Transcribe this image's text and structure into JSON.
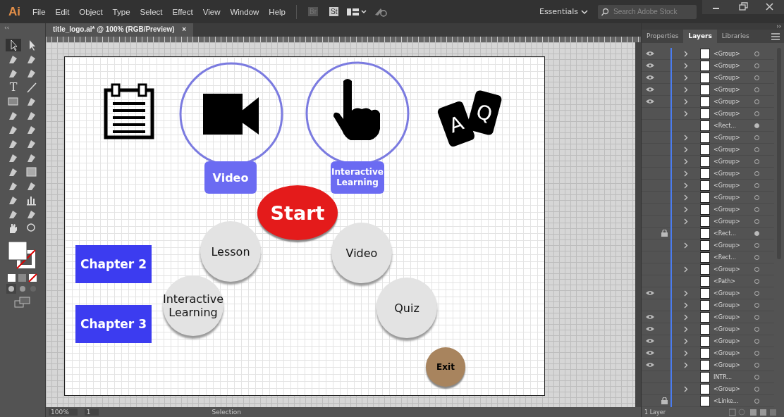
{
  "menu_bar": {
    "logo": "Ai",
    "menus": [
      "File",
      "Edit",
      "Object",
      "Type",
      "Select",
      "Effect",
      "View",
      "Window",
      "Help"
    ],
    "bridge": "Br",
    "stock": "St",
    "workspace": "Essentials",
    "search": {
      "placeholder": "Search Adobe Stock"
    }
  },
  "toolbar": {
    "collapse": "‹‹",
    "type_tool": "T"
  },
  "document_tab": {
    "title": "title_logo.ai* @ 100% (RGB/Preview)",
    "close": "×"
  },
  "artboard": {
    "video_button": "Video",
    "interactive_button": "Interactive Learning",
    "start": "Start",
    "lesson": "Lesson",
    "video": "Video",
    "interactive": "Interactive Learning",
    "quiz": "Quiz",
    "exit": "Exit",
    "chapter_2": "Chapter 2",
    "chapter_3": "Chapter 3",
    "card_letters": [
      "A",
      "Q"
    ]
  },
  "panel": {
    "expand": "››",
    "tabs": [
      {
        "label": "Properties",
        "selected": false
      },
      {
        "label": "Layers",
        "selected": true
      },
      {
        "label": "Libraries",
        "selected": false
      }
    ],
    "layers": [
      {
        "name": "<Group>",
        "visible": true,
        "locked": false,
        "expandable": true,
        "targeted": false
      },
      {
        "name": "<Group>",
        "visible": true,
        "locked": false,
        "expandable": true,
        "targeted": false
      },
      {
        "name": "<Group>",
        "visible": true,
        "locked": false,
        "expandable": true,
        "targeted": false
      },
      {
        "name": "<Group>",
        "visible": true,
        "locked": false,
        "expandable": true,
        "targeted": false
      },
      {
        "name": "<Group>",
        "visible": true,
        "locked": false,
        "expandable": true,
        "targeted": false
      },
      {
        "name": "<Group>",
        "visible": false,
        "locked": false,
        "expandable": true,
        "targeted": false
      },
      {
        "name": "<Rect...",
        "visible": false,
        "locked": false,
        "expandable": false,
        "targeted": true
      },
      {
        "name": "<Group>",
        "visible": false,
        "locked": false,
        "expandable": true,
        "targeted": false
      },
      {
        "name": "<Group>",
        "visible": false,
        "locked": false,
        "expandable": true,
        "targeted": false
      },
      {
        "name": "<Group>",
        "visible": false,
        "locked": false,
        "expandable": true,
        "targeted": false
      },
      {
        "name": "<Group>",
        "visible": false,
        "locked": false,
        "expandable": true,
        "targeted": false
      },
      {
        "name": "<Group>",
        "visible": false,
        "locked": false,
        "expandable": true,
        "targeted": false
      },
      {
        "name": "<Group>",
        "visible": false,
        "locked": false,
        "expandable": true,
        "targeted": false
      },
      {
        "name": "<Group>",
        "visible": false,
        "locked": false,
        "expandable": true,
        "targeted": false
      },
      {
        "name": "<Group>",
        "visible": false,
        "locked": false,
        "expandable": true,
        "targeted": false
      },
      {
        "name": "<Rect...",
        "visible": false,
        "locked": true,
        "expandable": false,
        "targeted": true
      },
      {
        "name": "<Group>",
        "visible": false,
        "locked": false,
        "expandable": true,
        "targeted": false
      },
      {
        "name": "<Rect...",
        "visible": false,
        "locked": false,
        "expandable": false,
        "targeted": false
      },
      {
        "name": "<Group>",
        "visible": false,
        "locked": false,
        "expandable": true,
        "targeted": false
      },
      {
        "name": "<Path>",
        "visible": false,
        "locked": false,
        "expandable": false,
        "targeted": false
      },
      {
        "name": "<Group>",
        "visible": true,
        "locked": false,
        "expandable": true,
        "targeted": false
      },
      {
        "name": "<Group>",
        "visible": false,
        "locked": false,
        "expandable": true,
        "targeted": false
      },
      {
        "name": "<Group>",
        "visible": true,
        "locked": false,
        "expandable": true,
        "targeted": false
      },
      {
        "name": "<Group>",
        "visible": true,
        "locked": false,
        "expandable": true,
        "targeted": false
      },
      {
        "name": "<Group>",
        "visible": true,
        "locked": false,
        "expandable": true,
        "targeted": false
      },
      {
        "name": "<Group>",
        "visible": true,
        "locked": false,
        "expandable": true,
        "targeted": false
      },
      {
        "name": "<Group>",
        "visible": true,
        "locked": false,
        "expandable": true,
        "targeted": false
      },
      {
        "name": "INTR...",
        "visible": false,
        "locked": false,
        "expandable": false,
        "targeted": false
      },
      {
        "name": "<Group>",
        "visible": false,
        "locked": false,
        "expandable": true,
        "targeted": false
      },
      {
        "name": "<Linke...",
        "visible": false,
        "locked": true,
        "expandable": false,
        "targeted": false
      }
    ],
    "footer": "1 Layer"
  },
  "status_bar": {
    "zoom": "100%",
    "artboard": "1",
    "tool": "Selection"
  }
}
